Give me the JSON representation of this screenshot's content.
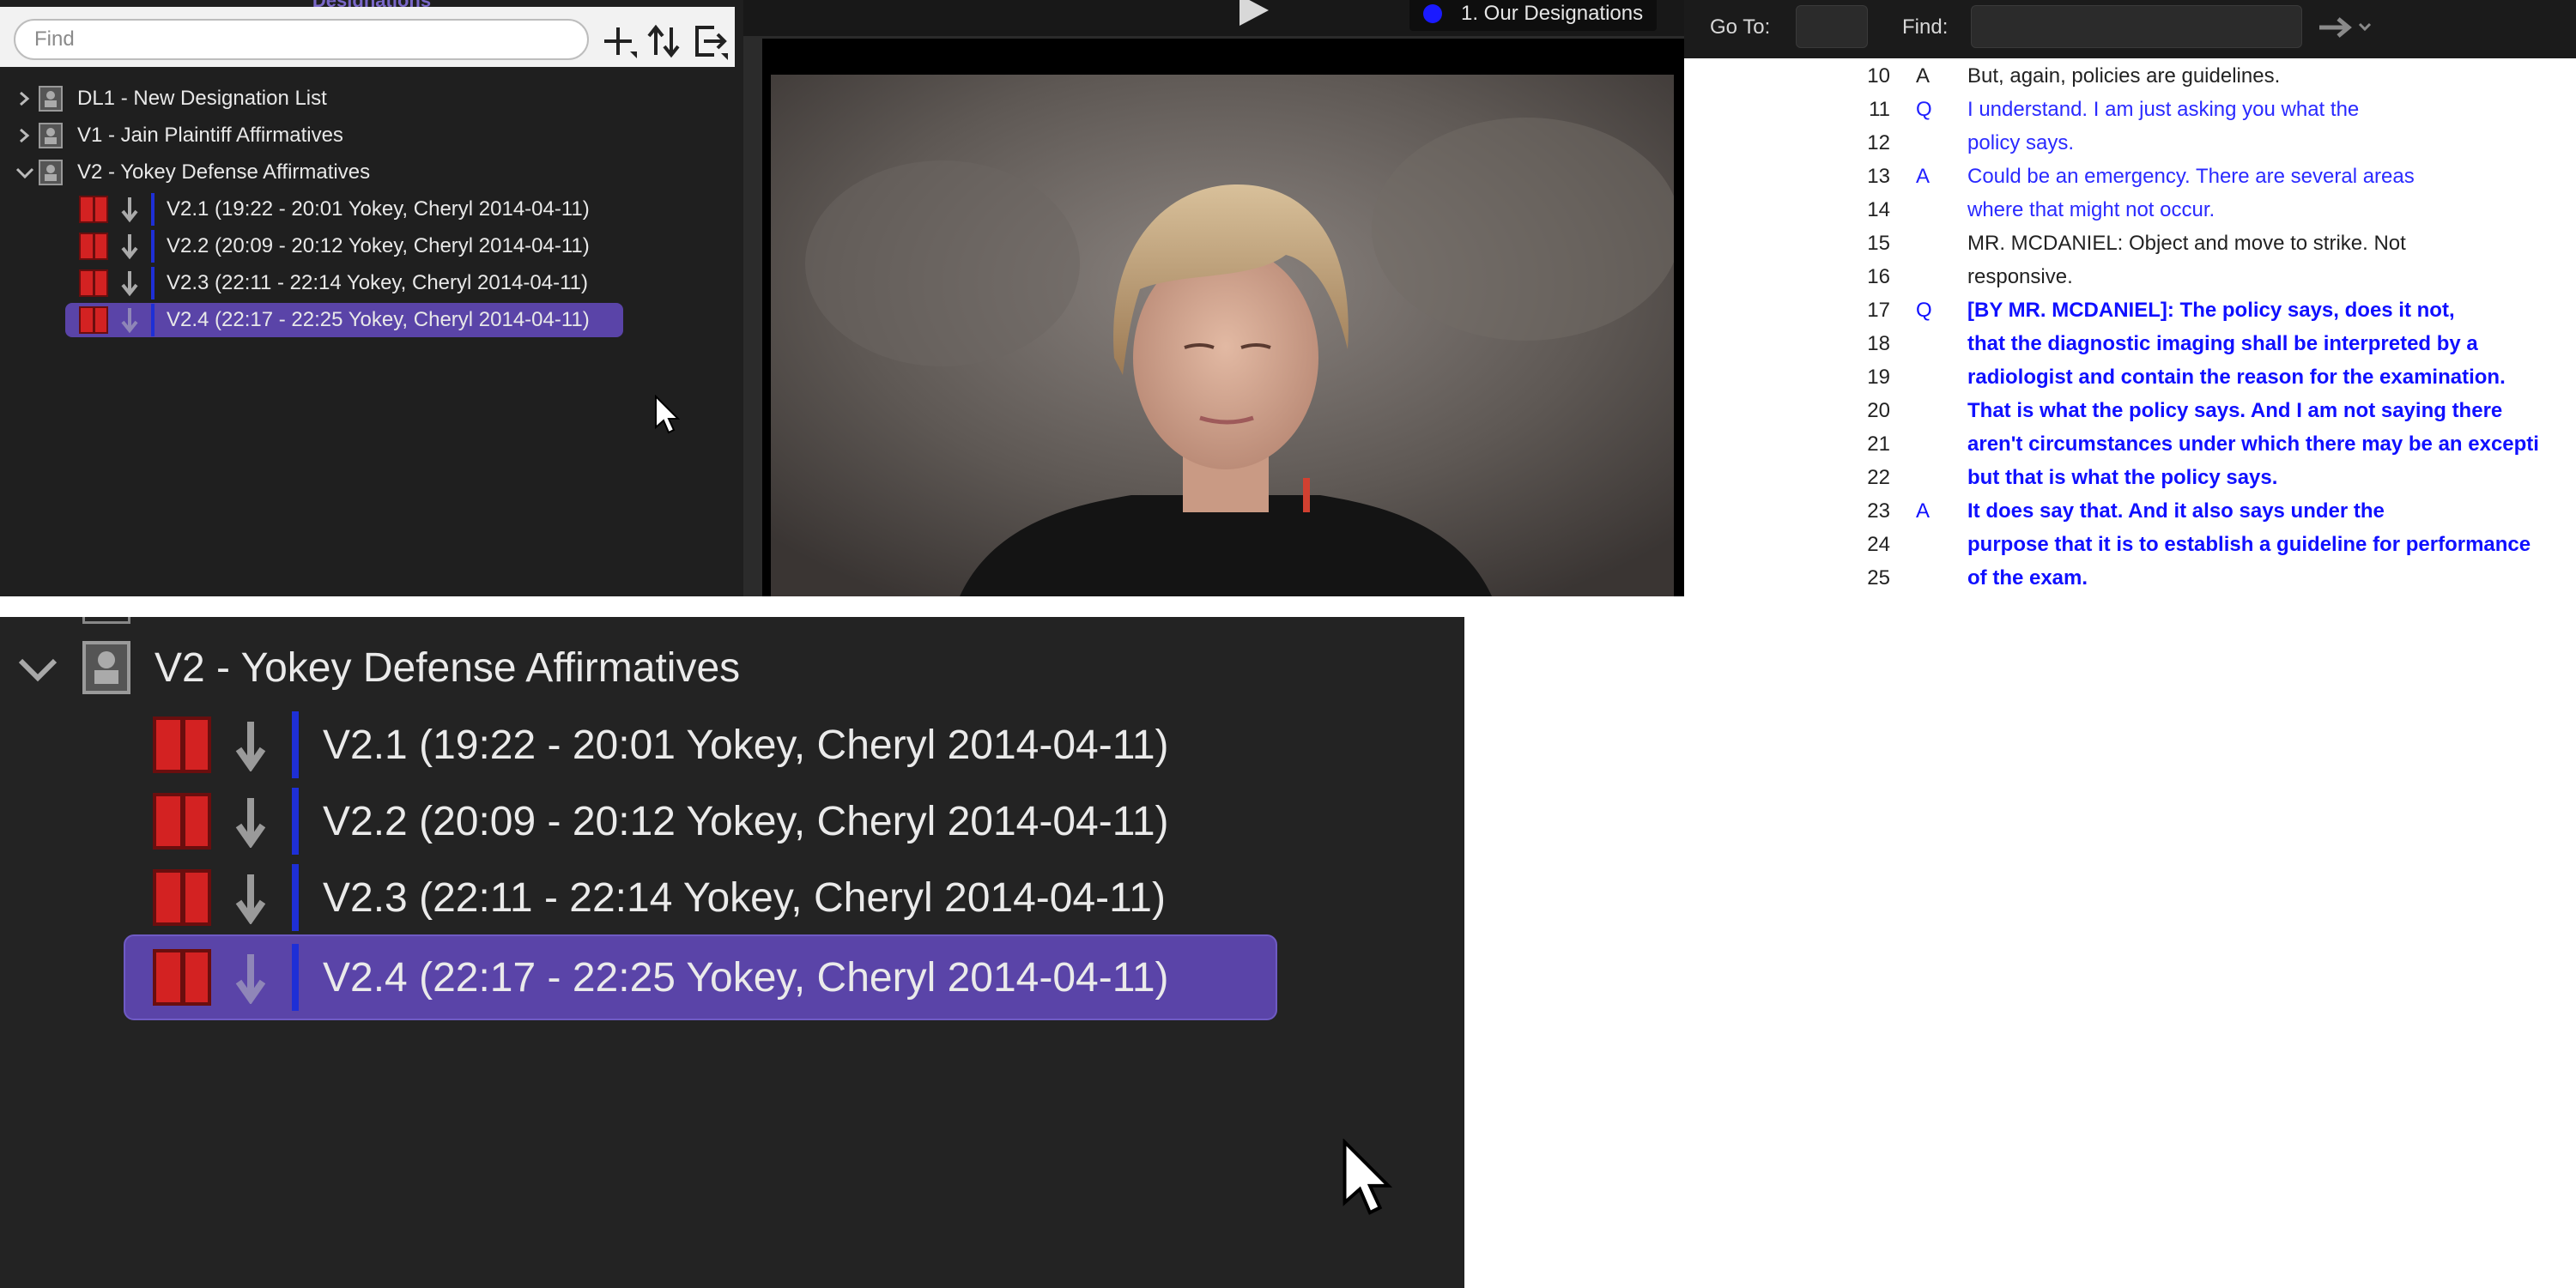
{
  "designations_panel": {
    "title": "Designations",
    "find_placeholder": "Find",
    "toolbar_icons": [
      "add-icon",
      "sort-icon",
      "export-icon"
    ],
    "tree": [
      {
        "label": "DL1 - New Designation List",
        "expanded": false
      },
      {
        "label": "V1 - Jain Plaintiff Affirmatives",
        "expanded": false
      },
      {
        "label": "V2 - Yokey Defense Affirmatives",
        "expanded": true,
        "children": [
          {
            "label": "V2.1 (19:22 - 20:01 Yokey, Cheryl 2014-04-11)",
            "selected": false
          },
          {
            "label": "V2.2 (20:09 - 20:12 Yokey, Cheryl 2014-04-11)",
            "selected": false
          },
          {
            "label": "V2.3 (22:11 - 22:14 Yokey, Cheryl 2014-04-11)",
            "selected": false
          },
          {
            "label": "V2.4 (22:17 - 22:25 Yokey, Cheryl 2014-04-11)",
            "selected": true
          }
        ]
      }
    ]
  },
  "video_panel": {
    "designation_badge": "1. Our Designations",
    "badge_color": "#1a1aff"
  },
  "transcript_panel": {
    "goto_label": "Go To:",
    "find_label": "Find:",
    "lines": [
      {
        "num": "10",
        "speaker": "A",
        "text": "But, again, policies are guidelines.",
        "style": "black"
      },
      {
        "num": "11",
        "speaker": "Q",
        "text": "I understand.  I am just asking you what the",
        "style": "blue"
      },
      {
        "num": "12",
        "speaker": "",
        "text": "policy says.",
        "style": "blue"
      },
      {
        "num": "13",
        "speaker": "A",
        "text": "Could be an emergency.  There are several areas",
        "style": "blue"
      },
      {
        "num": "14",
        "speaker": "",
        "text": "where that might not occur.",
        "style": "blue"
      },
      {
        "num": "15",
        "speaker": "",
        "text": "MR. MCDANIEL:  Object and move to strike.  Not",
        "style": "black"
      },
      {
        "num": "16",
        "speaker": "",
        "text": "responsive.",
        "style": "black"
      },
      {
        "num": "17",
        "speaker": "Q",
        "text": "[BY MR. MCDANIEL]:  The policy says, does it not,",
        "style": "bold"
      },
      {
        "num": "18",
        "speaker": "",
        "text": "that the diagnostic imaging shall be interpreted by a",
        "style": "bold"
      },
      {
        "num": "19",
        "speaker": "",
        "text": "radiologist and contain the reason for the examination.",
        "style": "bold"
      },
      {
        "num": "20",
        "speaker": "",
        "text": "That is what the policy says.  And I am not saying there",
        "style": "bold"
      },
      {
        "num": "21",
        "speaker": "",
        "text": "aren't circumstances under which there may be an excepti",
        "style": "bold"
      },
      {
        "num": "22",
        "speaker": "",
        "text": "but that is what the policy says.",
        "style": "bold"
      },
      {
        "num": "23",
        "speaker": "A",
        "text": "It does say that.  And it also says under the",
        "style": "bold"
      },
      {
        "num": "24",
        "speaker": "",
        "text": "purpose that it is to establish a guideline for performance",
        "style": "bold"
      },
      {
        "num": "25",
        "speaker": "",
        "text": "of the exam.",
        "style": "bold"
      }
    ]
  },
  "zoom_panel": {
    "group_label": "V2 - Yokey Defense Affirmatives",
    "items": [
      {
        "label": "V2.1 (19:22 - 20:01 Yokey, Cheryl 2014-04-11)"
      },
      {
        "label": "V2.2 (20:09 - 20:12 Yokey, Cheryl 2014-04-11)"
      },
      {
        "label": "V2.3 (22:11 - 22:14 Yokey, Cheryl 2014-04-11)"
      },
      {
        "label": "V2.4 (22:17 - 22:25 Yokey, Cheryl 2014-04-11)"
      }
    ]
  }
}
